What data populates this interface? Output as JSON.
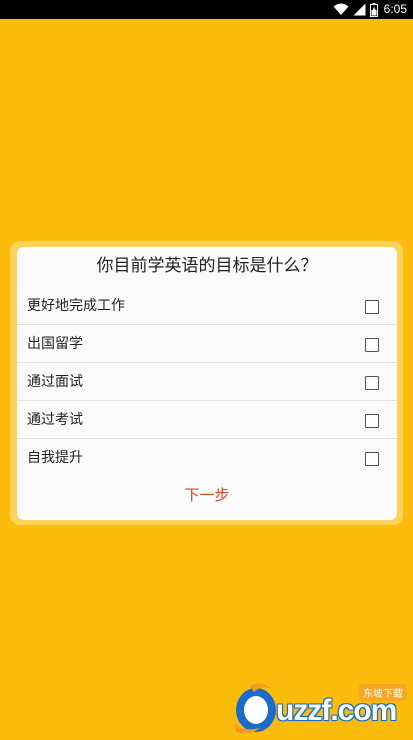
{
  "status_bar": {
    "time": "6:05",
    "icons": [
      "wifi-icon",
      "signal-icon",
      "battery-icon"
    ]
  },
  "dialog": {
    "title": "你目前学英语的目标是什么？",
    "options": [
      {
        "label": "更好地完成工作",
        "checked": false
      },
      {
        "label": "出国留学",
        "checked": false
      },
      {
        "label": "通过面试",
        "checked": false
      },
      {
        "label": "通过考试",
        "checked": false
      },
      {
        "label": "自我提升",
        "checked": false
      }
    ],
    "next_label": "下一步"
  },
  "watermark": {
    "brand": "uzzf.com",
    "badge": "东坡下载"
  },
  "colors": {
    "background": "#fbbc0c",
    "accent": "#cf4a1c",
    "dialog": "#fbfbfb"
  }
}
